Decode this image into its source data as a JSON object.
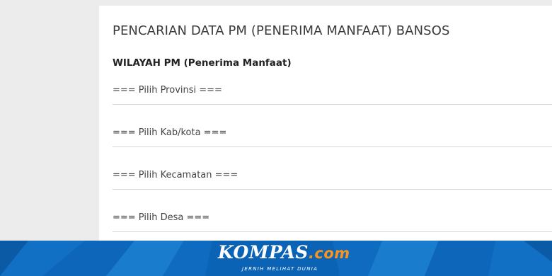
{
  "form": {
    "title": "PENCARIAN DATA PM (PENERIMA MANFAAT) BANSOS",
    "section_label": "WILAYAH PM (Penerima Manfaat)",
    "fields": {
      "provinsi": "=== Pilih Provinsi ===",
      "kabkota": "=== Pilih Kab/kota ===",
      "kecamatan": "=== Pilih Kecamatan ===",
      "desa": "=== Pilih Desa ==="
    }
  },
  "banner": {
    "brand": "KOMPAS",
    "brand_suffix": ".com",
    "tagline": "JERNIH MELIHAT DUNIA"
  },
  "colors": {
    "banner_blue": "#0b63b6",
    "brand_orange": "#f7941d"
  }
}
